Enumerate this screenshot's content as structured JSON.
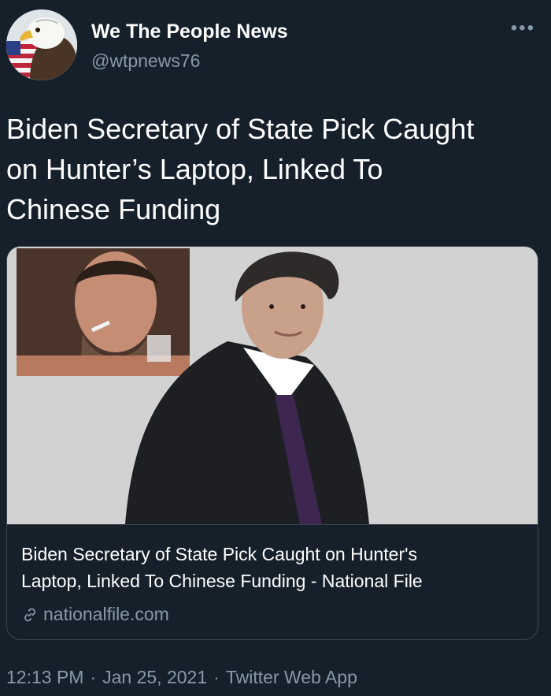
{
  "account": {
    "display_name": "We The People News",
    "handle": "@wtpnews76"
  },
  "tweet": {
    "text_line1": "Biden Secretary of State Pick Caught",
    "text_line2": "on Hunter’s Laptop, Linked To",
    "text_line3": "Chinese Funding"
  },
  "card": {
    "title_line1": "Biden Secretary of State Pick Caught on Hunter's",
    "title_line2": "Laptop, Linked To Chinese Funding - National File",
    "domain": "nationalfile.com"
  },
  "meta": {
    "time": "12:13 PM",
    "sep1": "·",
    "date": "Jan 25, 2021",
    "sep2": "·",
    "source": "Twitter Web App"
  },
  "icons": {
    "more": "more-icon",
    "link": "link-icon",
    "avatar": "eagle-flag-avatar"
  },
  "colors": {
    "background": "#15202b",
    "secondary_text": "#8899a6",
    "border": "#38444d"
  }
}
